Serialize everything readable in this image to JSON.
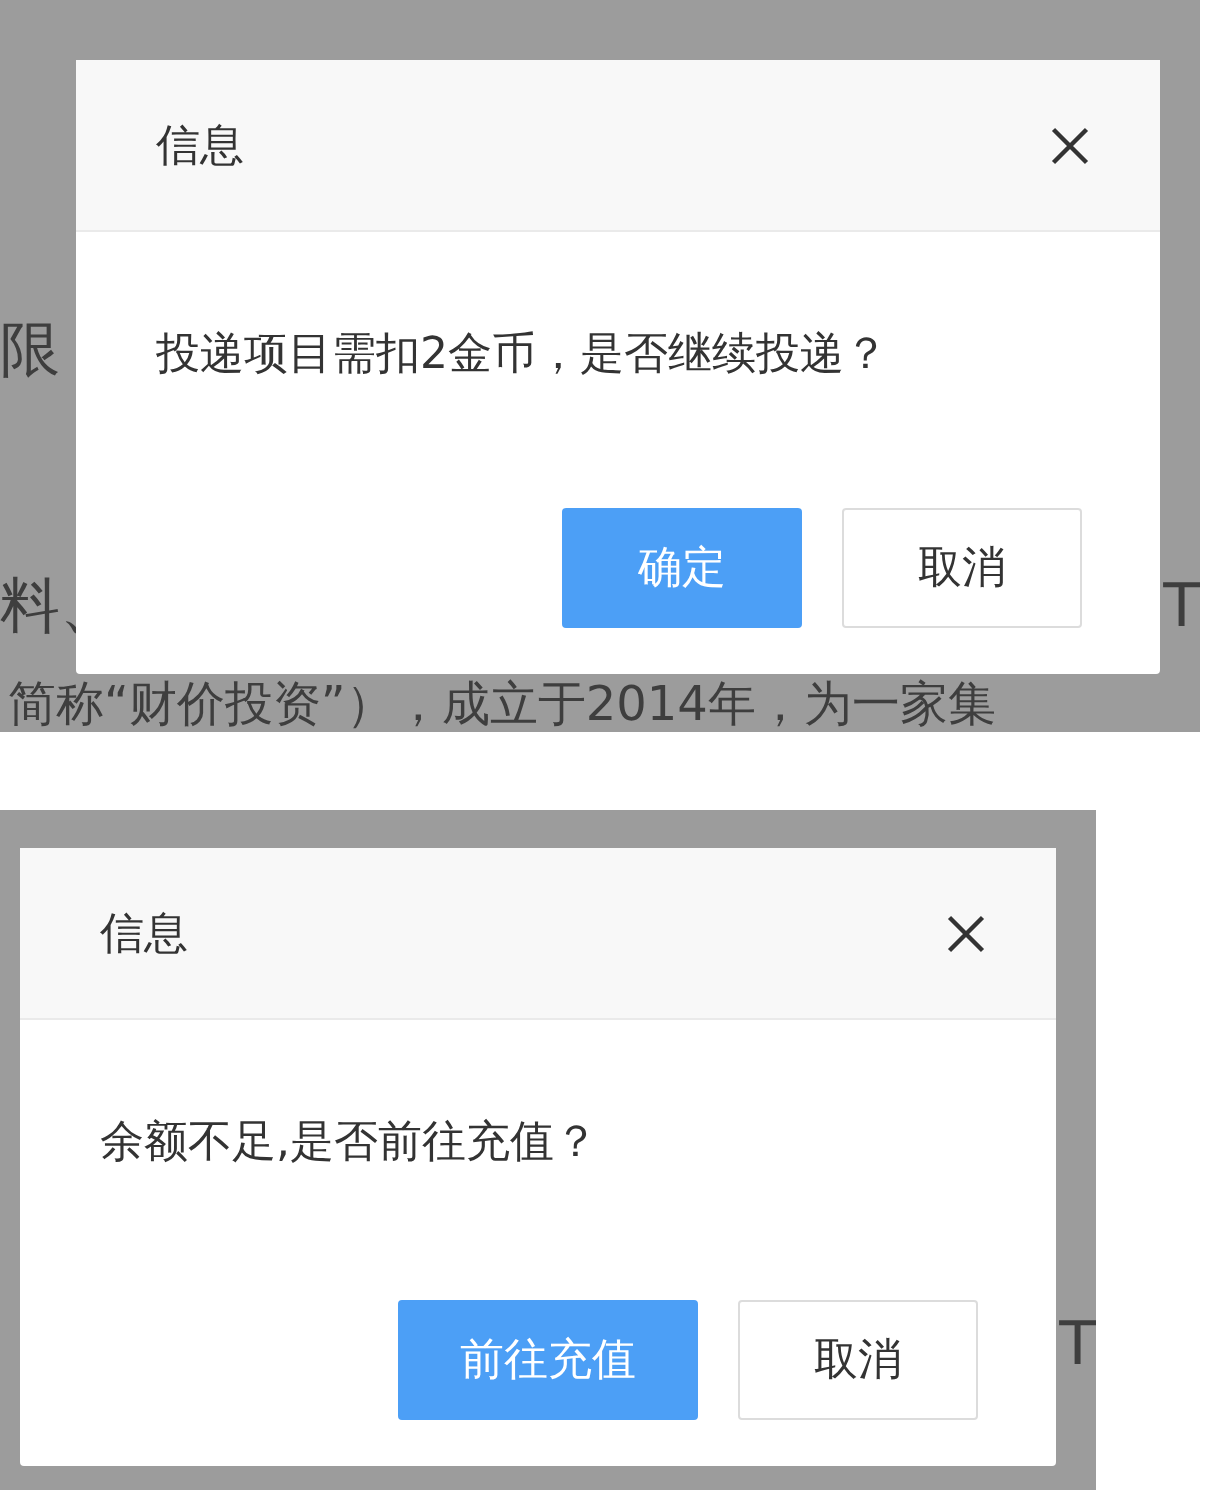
{
  "screens": [
    {
      "background_middle": {
        "left": "限"
      },
      "background_lower": {
        "left": "料、",
        "right": "T"
      },
      "background_footer": "简称“财价投资”），成立于2014年，为一家集",
      "dialog": {
        "title": "信息",
        "message": "投递项目需扣2金币，是否继续投递？",
        "buttons": [
          {
            "label": "确定",
            "kind": "primary"
          },
          {
            "label": "取消",
            "kind": "default"
          }
        ]
      }
    },
    {
      "background_lower": {
        "right": "T"
      },
      "dialog": {
        "title": "信息",
        "message": "余额不足,是否前往充值？",
        "buttons": [
          {
            "label": "前往充值",
            "kind": "primary"
          },
          {
            "label": "取消",
            "kind": "default"
          }
        ]
      }
    }
  ]
}
